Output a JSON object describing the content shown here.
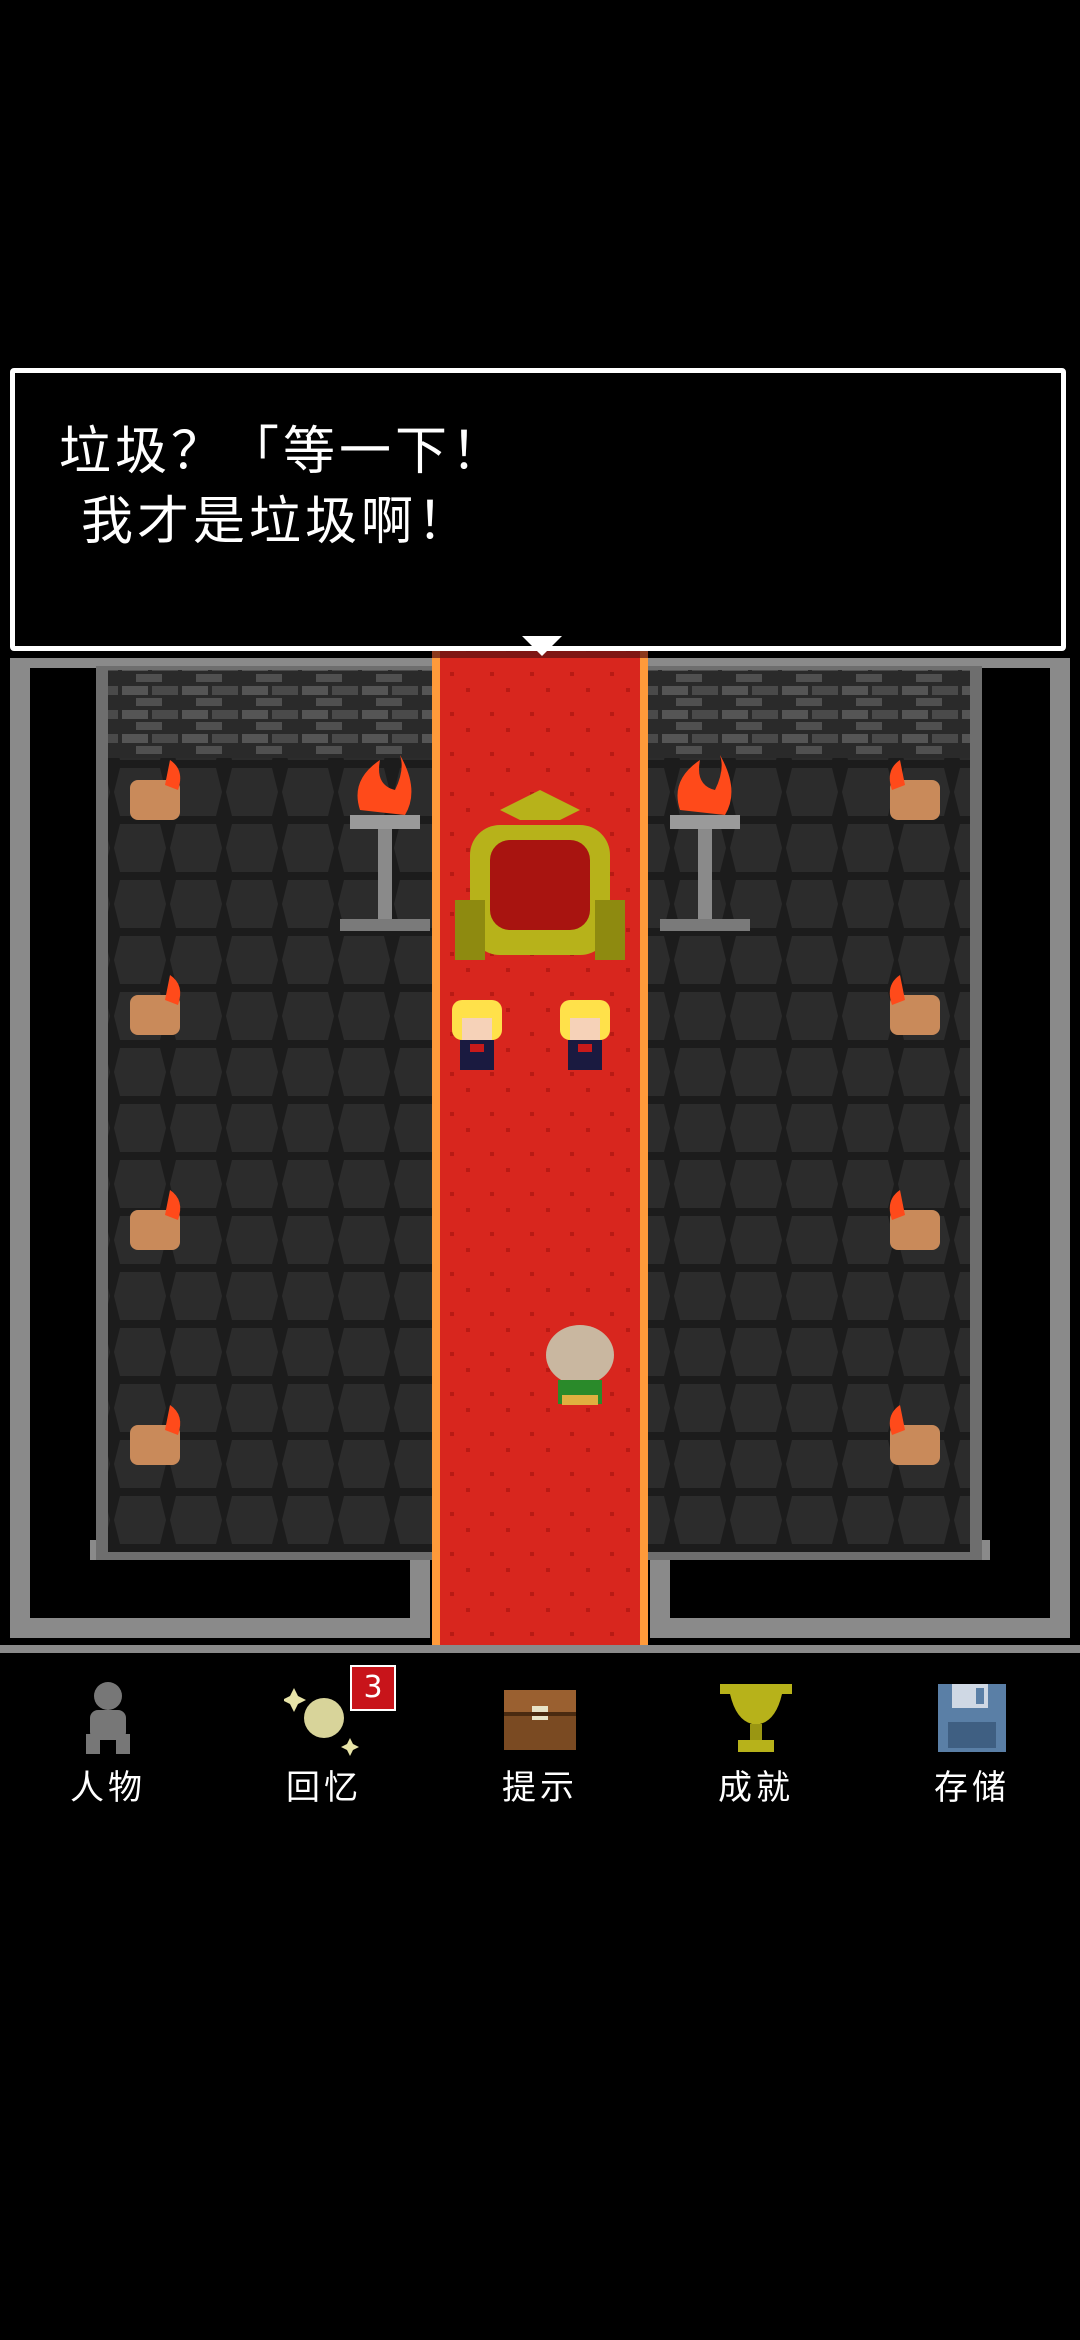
{
  "dialog": {
    "line1": "垃圾？「等一下！",
    "line2": "我才是垃圾啊！"
  },
  "menu": {
    "items": [
      {
        "label": "人物",
        "icon": "character-silhouette-icon"
      },
      {
        "label": "回忆",
        "icon": "sparkle-memory-icon",
        "badge": "3"
      },
      {
        "label": "提示",
        "icon": "treasure-chest-icon"
      },
      {
        "label": "成就",
        "icon": "trophy-icon"
      },
      {
        "label": "存储",
        "icon": "floppy-disk-icon"
      }
    ]
  },
  "colors": {
    "carpet": "#d8261e",
    "stone_wall": "#3a3a3a",
    "floor": "#242424",
    "frame": "#8a8a8a",
    "flame": "#ff4a1a",
    "gold": "#b7b21a",
    "badge": "#c8141a"
  }
}
